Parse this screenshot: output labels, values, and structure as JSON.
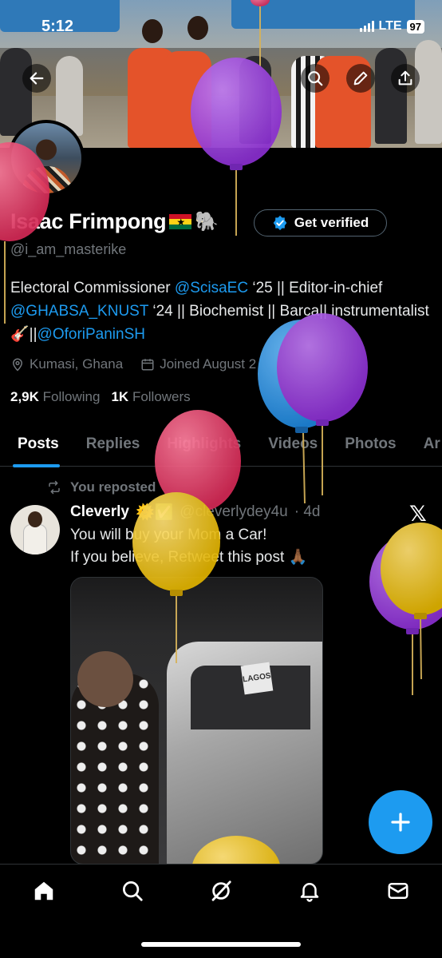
{
  "status_bar": {
    "time": "5:12",
    "network": "LTE",
    "battery": "97"
  },
  "profile": {
    "name": "Isaac Frimpong",
    "handle": "@i_am_masterike",
    "verify_label": "Get verified",
    "bio": {
      "part1": "Electoral Commissioner ",
      "link1": "@ScisaEC",
      "part2": " ‘25 || Editor-in-chief ",
      "link2": "@GHABSA_KNUST",
      "part3": " ‘24 || Biochemist || Barca|| instrumentalist 🎸||",
      "link3": "@OforiPaninSH"
    },
    "location": "Kumasi, Ghana",
    "joined": "Joined August 2",
    "following_count": "2,9K",
    "following_label": "Following",
    "followers_count": "1K",
    "followers_label": "Followers"
  },
  "tabs": [
    "Posts",
    "Replies",
    "Highlights",
    "Videos",
    "Photos",
    "Ar"
  ],
  "post": {
    "repost_label": "You reposted",
    "author_name": "Cleverly",
    "author_handle": "@cleverlydey4u",
    "age": "· 4d",
    "line1": "You will buy your Mom a Car!",
    "line2": "If you believe, Retweet this post 🙏🏾",
    "plate_text": "LAGOS"
  },
  "colors": {
    "accent": "#1d9bf0",
    "background": "#000000",
    "muted": "#71767b"
  },
  "icons": [
    "back-arrow-icon",
    "search-icon",
    "edit-pen-icon",
    "share-icon",
    "verified-badge-icon",
    "location-icon",
    "calendar-icon",
    "repost-icon",
    "x-logo-icon",
    "plus-icon",
    "home-icon",
    "explore-search-icon",
    "grok-icon",
    "notifications-bell-icon",
    "messages-envelope-icon"
  ]
}
